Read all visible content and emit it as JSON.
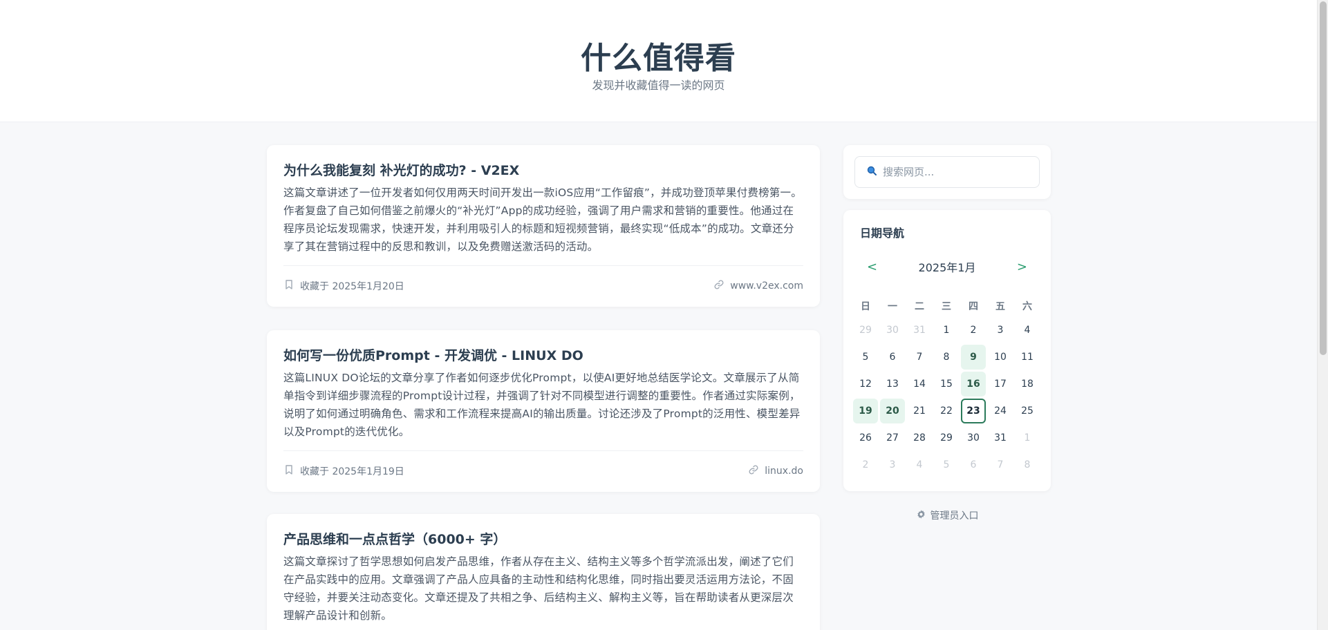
{
  "header": {
    "title": "什么值得看",
    "subtitle": "发现并收藏值得一读的网页"
  },
  "articles": [
    {
      "title": "为什么我能复刻 补光灯的成功? - V2EX",
      "description": "这篇文章讲述了一位开发者如何仅用两天时间开发出一款iOS应用“工作留痕”，并成功登顶苹果付费榜第一。作者复盘了自己如何借鉴之前爆火的“补光灯”App的成功经验，强调了用户需求和营销的重要性。他通过在程序员论坛发现需求，快速开发，并利用吸引人的标题和短视频营销，最终实现“低成本”的成功。文章还分享了其在营销过程中的反思和教训，以及免费赠送激活码的活动。",
      "saved": "收藏于 2025年1月20日",
      "domain": "www.v2ex.com"
    },
    {
      "title": "如何写一份优质Prompt - 开发调优 - LINUX DO",
      "description": "这篇LINUX DO论坛的文章分享了作者如何逐步优化Prompt，以使AI更好地总结医学论文。文章展示了从简单指令到详细步骤流程的Prompt设计过程，并强调了针对不同模型进行调整的重要性。作者通过实际案例，说明了如何通过明确角色、需求和工作流程来提高AI的输出质量。讨论还涉及了Prompt的泛用性、模型差异以及Prompt的迭代优化。",
      "saved": "收藏于 2025年1月19日",
      "domain": "linux.do"
    },
    {
      "title": "产品思维和一点点哲学（6000+ 字）",
      "description": "这篇文章探讨了哲学思想如何启发产品思维，作者从存在主义、结构主义等多个哲学流派出发，阐述了它们在产品实践中的应用。文章强调了产品人应具备的主动性和结构化思维，同时指出要灵活运用方法论，不固守经验，并要关注动态变化。文章还提及了共相之争、后结构主义、解构主义等，旨在帮助读者从更深层次理解产品设计和创新。"
    }
  ],
  "search": {
    "placeholder": "搜索网页..."
  },
  "calendar": {
    "title": "日期导航",
    "month": "2025年1月",
    "prev": "<",
    "next": ">",
    "weekdays": [
      "日",
      "一",
      "二",
      "三",
      "四",
      "五",
      "六"
    ],
    "weeks": [
      [
        [
          "29",
          "m"
        ],
        [
          "30",
          "m"
        ],
        [
          "31",
          "m"
        ],
        [
          "1",
          ""
        ],
        [
          "2",
          ""
        ],
        [
          "3",
          ""
        ],
        [
          "4",
          ""
        ]
      ],
      [
        [
          "5",
          ""
        ],
        [
          "6",
          ""
        ],
        [
          "7",
          ""
        ],
        [
          "8",
          ""
        ],
        [
          "9",
          "h"
        ],
        [
          "10",
          ""
        ],
        [
          "11",
          ""
        ]
      ],
      [
        [
          "12",
          ""
        ],
        [
          "13",
          ""
        ],
        [
          "14",
          ""
        ],
        [
          "15",
          ""
        ],
        [
          "16",
          "h"
        ],
        [
          "17",
          ""
        ],
        [
          "18",
          ""
        ]
      ],
      [
        [
          "19",
          "h"
        ],
        [
          "20",
          "h"
        ],
        [
          "21",
          ""
        ],
        [
          "22",
          ""
        ],
        [
          "23",
          "t"
        ],
        [
          "24",
          ""
        ],
        [
          "25",
          ""
        ]
      ],
      [
        [
          "26",
          ""
        ],
        [
          "27",
          ""
        ],
        [
          "28",
          ""
        ],
        [
          "29",
          ""
        ],
        [
          "30",
          ""
        ],
        [
          "31",
          ""
        ],
        [
          "1",
          "m"
        ]
      ],
      [
        [
          "2",
          "m"
        ],
        [
          "3",
          "m"
        ],
        [
          "4",
          "m"
        ],
        [
          "5",
          "m"
        ],
        [
          "6",
          "m"
        ],
        [
          "7",
          "m"
        ],
        [
          "8",
          "m"
        ]
      ]
    ]
  },
  "admin": {
    "label": "管理员入口"
  },
  "colors": {
    "accent": "#2a9d6f",
    "highlight": "#e6f5ee",
    "today_border": "#2a7a5a"
  }
}
